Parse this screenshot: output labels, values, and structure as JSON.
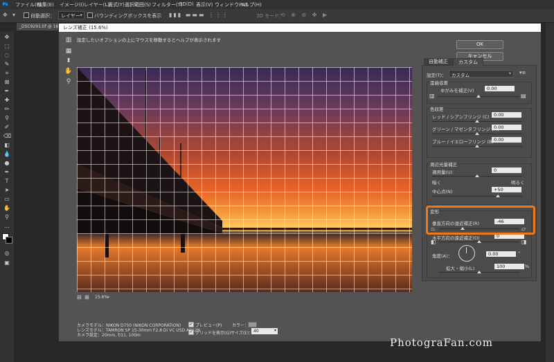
{
  "menu": [
    "ファイル(F)",
    "編集(E)",
    "イメージ(I)",
    "レイヤー(L)",
    "書式(Y)",
    "選択範囲(S)",
    "フィルター(T)",
    "3D(D)",
    "表示(V)",
    "ウィンドウ(W)",
    "ヘルプ(H)"
  ],
  "app_logo": "Ps",
  "options": {
    "auto_select": "自動選択：",
    "layer_select": "レイヤー",
    "show_bbox": "バウンディングボックスを表示",
    "mode_3d": "3D モード："
  },
  "doc_tab": "_DSC9291.tif @ 16.7...",
  "dialog": {
    "title": "レンズ補正 (15.6%)",
    "hint": "設定したいオプションの上にマウスを移動するとヘルプが表示されます",
    "ok": "OK",
    "cancel": "キャンセル",
    "zoom": "15.6%",
    "camera_model": "カメラモデル：NIKON D750 (NIKON CORPORATION)",
    "lens_model": "レンズモデル：TAMRON SP 15-30mm F2.8 Di VC USD A012N",
    "camera_settings": "カメラ設定：20mm, f/11, 100m",
    "preview_label": "プレビュー(P)",
    "grid_label": "グリッドを表示(G)",
    "color_label": "カラー：",
    "size_label": "サイズ(E)：",
    "size_value": "40"
  },
  "panel": {
    "tab_auto": "自動補正",
    "tab_custom": "カスタム",
    "settings_label": "設定(T)：",
    "settings_value": "カスタム",
    "geometric": {
      "title": "歪曲収差",
      "distortion_label": "ゆがみを補正(V)",
      "distortion_value": "0.00"
    },
    "chromatic": {
      "title": "色収差",
      "red_cyan_label": "レッド / シアンフリンジ (C)",
      "red_cyan_value": "0.00",
      "green_magenta_label": "グリーン / マゼンタフリンジ (M)",
      "green_magenta_value": "0.00",
      "blue_yellow_label": "ブルー / イエローフリンジ (B)",
      "blue_yellow_value": "0.00"
    },
    "vignette": {
      "title": "周辺光量補正",
      "amount_label": "適用量(U)",
      "amount_value": "0",
      "dark": "暗く",
      "bright": "明るく",
      "midpoint_label": "中心点(N)",
      "midpoint_value": "+50"
    },
    "transform": {
      "title": "変形",
      "vertical_label": "垂直方向の遠近補正(R)",
      "vertical_value": "-46",
      "horizontal_label": "水平方向の遠近補正(O)",
      "horizontal_value": "0",
      "angle_label": "角度(A)：",
      "angle_value": "0.00",
      "degree": "°",
      "scale_label": "拡大・縮小(L)",
      "scale_value": "100",
      "percent": "%"
    }
  },
  "watermark": "PhotograFan.com",
  "colors": {
    "highlight": "#f07a1a",
    "title_bg": "#ffffff"
  }
}
